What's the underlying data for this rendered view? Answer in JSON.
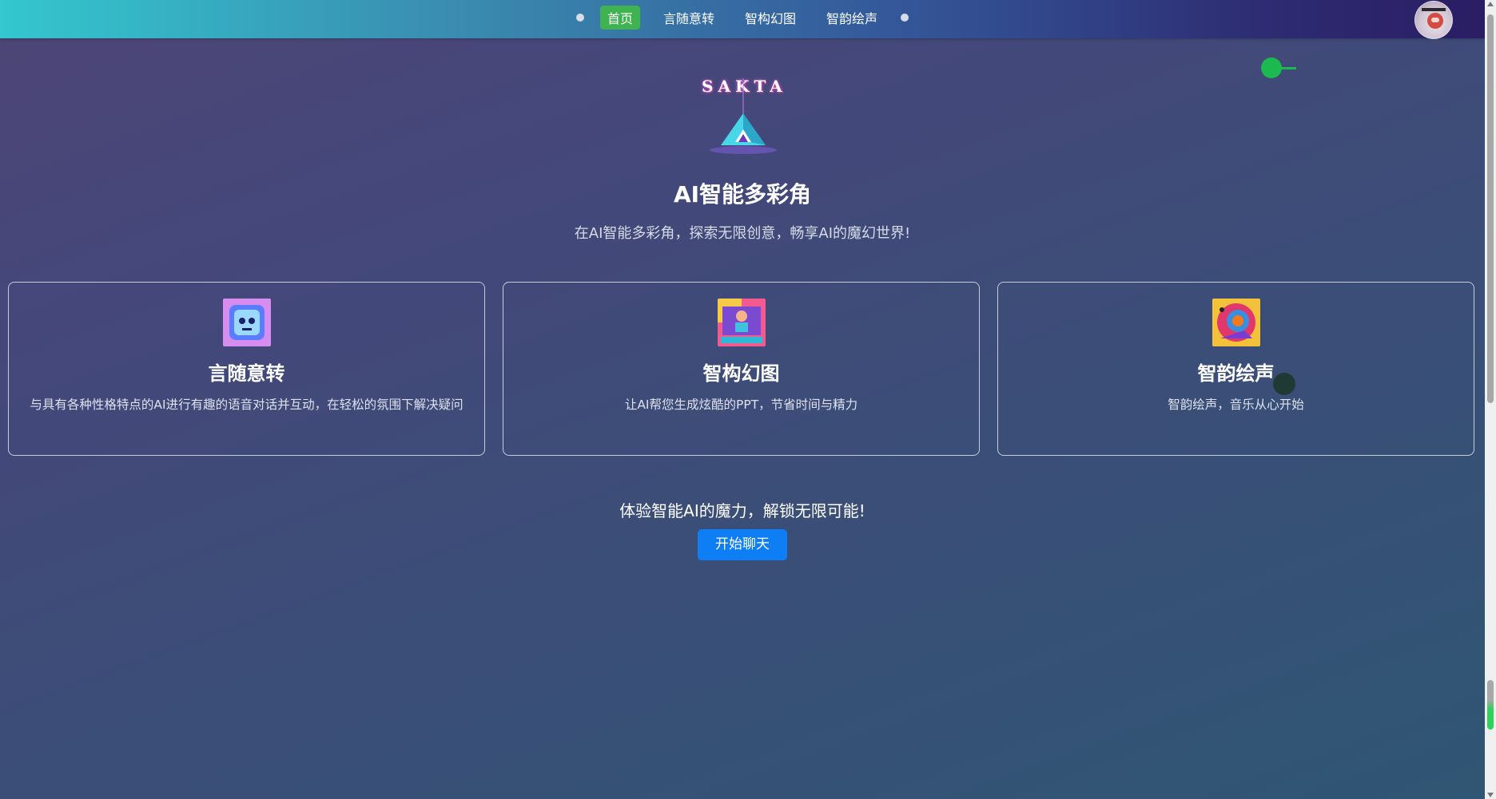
{
  "nav": {
    "items": [
      {
        "label": "首页",
        "active": true
      },
      {
        "label": "言随意转",
        "active": false
      },
      {
        "label": "智构幻图",
        "active": false
      },
      {
        "label": "智韵绘声",
        "active": false
      }
    ]
  },
  "logo": {
    "text": "SAKTA"
  },
  "hero": {
    "title": "AI智能多彩角",
    "subtitle": "在AI智能多彩角，探索无限创意，畅享AI的魔幻世界!"
  },
  "cards": [
    {
      "title": "言随意转",
      "description": "与具有各种性格特点的AI进行有趣的语音对话并互动，在轻松的氛围下解决疑问",
      "icon": "robot-cube-icon"
    },
    {
      "title": "智构幻图",
      "description": "让AI帮您生成炫酷的PPT，节省时间与精力",
      "icon": "presentation-art-icon"
    },
    {
      "title": "智韵绘声",
      "description": "智韵绘声，音乐从心开始",
      "icon": "music-head-icon"
    }
  ],
  "cta": {
    "text": "体验智能AI的魔力，解锁无限可能!",
    "button": "开始聊天"
  },
  "colors": {
    "active_nav": "#3fb34f",
    "cta_button": "#0d7ef4",
    "slider_green": "#1bb94f"
  }
}
